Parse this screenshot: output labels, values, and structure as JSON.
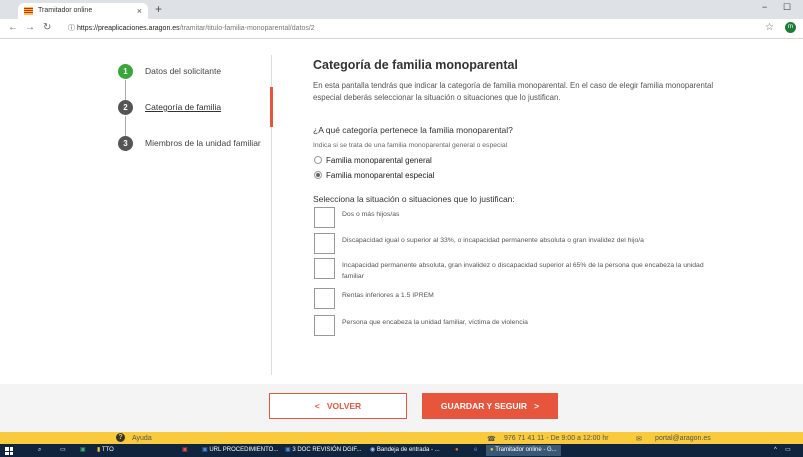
{
  "browser": {
    "tab_title": "Tramitador online",
    "tab_close": "×",
    "new_tab": "+",
    "url_host": "https://preaplicaciones.aragon.es",
    "url_path": "/tramitar/titulo-familia-monoparental/datos/2",
    "avatar_initial": "m",
    "minimize": "−",
    "maximize": "☐"
  },
  "steps": [
    {
      "number": "1",
      "label": "Datos del solicitante",
      "color": "#3aa63a"
    },
    {
      "number": "2",
      "label": "Categoría de familia",
      "color": "#555555"
    },
    {
      "number": "3",
      "label": "Miembros de la unidad familiar",
      "color": "#555555"
    }
  ],
  "main": {
    "title": "Categoría de familia monoparental",
    "intro": "En esta pantalla tendrás que indicar la categoría de familia monoparental. En el caso de elegir familia monoparental especial deberás seleccionar la situación o situaciones que lo justifican.",
    "question1": "¿A qué categoría pertenece la familia monoparental?",
    "hint": "Indica si se trata de una familia monoparental general o especial",
    "options": [
      {
        "label": "Familia monoparental general",
        "selected": false
      },
      {
        "label": "Familia monoparental especial",
        "selected": true
      }
    ],
    "question2": "Selecciona la situación o situaciones que lo justifican:",
    "checks": [
      "Dos o más hijos/as",
      "Discapacidad igual o superior al 33%, o incapacidad permanente absoluta o gran invalidez del hijo/a",
      "Incapacidad permanente absoluta, gran invalidez o discapacidad superior al 65% de la persona que encabeza la unidad familiar",
      "Rentas inferiores a 1.5 IPREM",
      "Persona que encabeza la unidad familiar, víctima de violencia"
    ]
  },
  "footer": {
    "back_label": "VOLVER",
    "next_label": "GUARDAR Y SEGUIR",
    "help": "Ayuda",
    "phone": "976 71 41 11 - De 9:00 a 12:00 hr",
    "email": "portal@aragon.es",
    "accent": "#e8553d",
    "bar_color": "#f8ca3c"
  },
  "taskbar": {
    "items": [
      "TTO",
      "URL PROCEDIMIENTO...",
      "3 DOC REVISIÓN DGIF...",
      "Bandeja de entrada - ...",
      "Tramitador online - G..."
    ]
  }
}
